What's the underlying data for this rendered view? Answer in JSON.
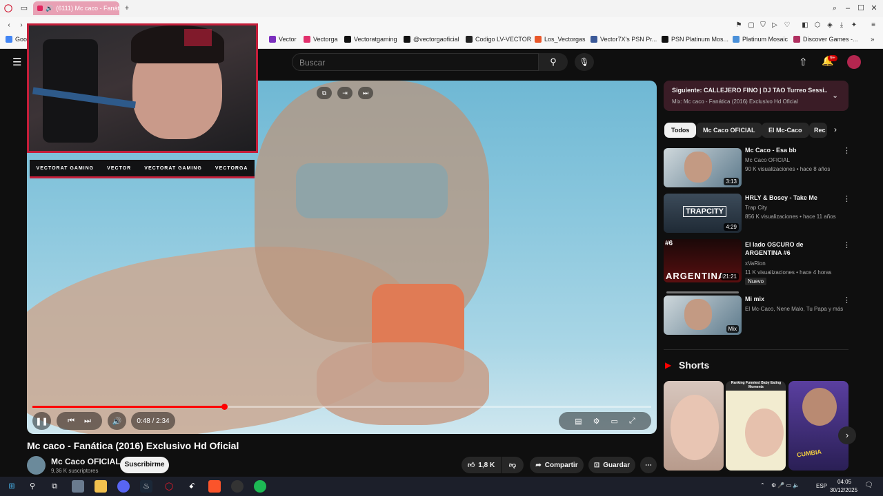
{
  "browser": {
    "tab_title": "(6111) Mc caco - Fanát",
    "new_tab": "+",
    "bookmarks": [
      {
        "label": "Goo",
        "color": "#4285f4"
      },
      {
        "label": "Vector",
        "color": "#7b2fbe"
      },
      {
        "label": "Vectorga",
        "color": "#e1306c"
      },
      {
        "label": "Vectoratgaming",
        "color": "#111111"
      },
      {
        "label": "@vectorgaoficial",
        "color": "#111111"
      },
      {
        "label": "Codigo LV-VECTOR",
        "color": "#222222"
      },
      {
        "label": "Los_Vectorgas",
        "color": "#e8572a"
      },
      {
        "label": "Vector7X's PSN Pr...",
        "color": "#3b5998"
      },
      {
        "label": "PSN Platinum Mos...",
        "color": "#111111"
      },
      {
        "label": "Platinum Mosaic",
        "color": "#4a90d9"
      },
      {
        "label": "Discover Games -...",
        "color": "#b03060"
      }
    ]
  },
  "youtube": {
    "search_placeholder": "Buscar",
    "notifications_badge": "9+"
  },
  "video": {
    "time": "0:48 / 2:34",
    "progress": 0.31,
    "title": "Mc caco - Fanática (2016) Exclusivo Hd Oficial",
    "channel": "Mc Caco OFICIAL",
    "subscribers": "9,36 K suscriptores",
    "subscribe_label": "Suscribirme",
    "likes": "1,8 K",
    "share_label": "Compartir",
    "save_label": "Guardar"
  },
  "overlay": {
    "social": [
      "VECTORAT GAMING",
      "VECTOR",
      "VECTORAT GAMING",
      "VECTORGA"
    ]
  },
  "sidebar": {
    "next_title": "Siguiente: CALLEJERO FINO | DJ TAO Turreo Sessi...",
    "next_sub": "Mix: Mc caco - Fanática (2016) Exclusivo Hd Oficial",
    "chips": [
      "Todos",
      "Mc Caco OFICIAL",
      "El Mc-Caco",
      "Rec"
    ],
    "videos": [
      {
        "title": "Mc Caco - Esa bb",
        "channel": "Mc Caco OFICIAL",
        "meta": "90 K visualizaciones • hace 8 años",
        "duration": "3:13"
      },
      {
        "title": "HRLY & Bosey - Take Me",
        "channel": "Trap City",
        "meta": "856 K visualizaciones • hace 11 años",
        "duration": "4:29",
        "thumb_text": "TRAPCITY"
      },
      {
        "title": "El lado OSCURO de ARGENTINA #6",
        "channel": "xVaRion",
        "meta": "11 K visualizaciones • hace 4 horas",
        "badge": "Nuevo",
        "duration": "21:21",
        "thumb_text": "ARGENTINA",
        "thumb_tag": "#6"
      },
      {
        "title": "Mi mix",
        "channel": "El Mc-Caco, Nene Malo, Tu Papa y más",
        "meta": "",
        "duration": "Mix"
      }
    ],
    "shorts_title": "Shorts",
    "shorts": [
      {
        "caption": ""
      },
      {
        "caption": "Ranking Funniest Baby Eating Moments"
      },
      {
        "caption": "CUMBIA"
      }
    ]
  },
  "taskbar": {
    "lang": "ESP",
    "time": "04:05",
    "date": "30/12/2025"
  }
}
